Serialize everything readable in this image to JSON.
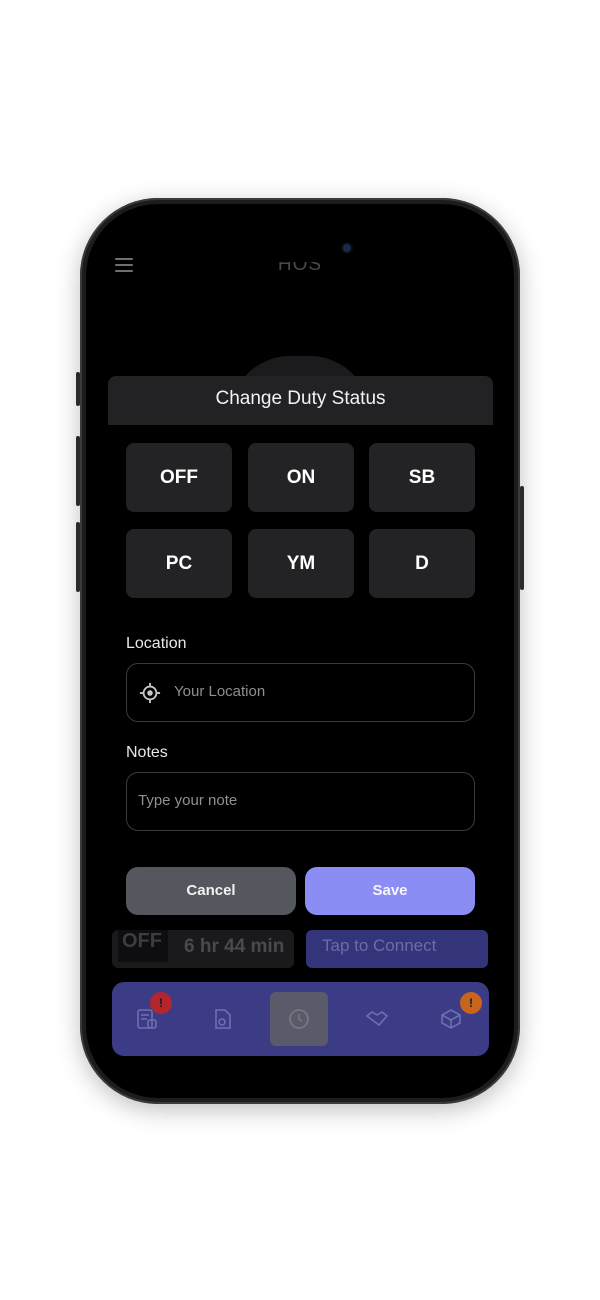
{
  "app": {
    "title": "HOS"
  },
  "modal": {
    "title": "Change Duty Status",
    "statuses": [
      "OFF",
      "ON",
      "SB",
      "PC",
      "YM",
      "D"
    ],
    "location": {
      "label": "Location",
      "placeholder": "Your Location",
      "icon": "crosshair-location-icon"
    },
    "notes": {
      "label": "Notes",
      "placeholder": "Type your note"
    },
    "cancel_label": "Cancel",
    "save_label": "Save"
  },
  "background": {
    "current_status": "OFF",
    "remaining_time": "6 hr 44 min",
    "connect_label": "Tap to Connect"
  },
  "bottom_nav": {
    "items": [
      {
        "icon": "logs-icon",
        "badge": "!"
      },
      {
        "icon": "document-icon"
      },
      {
        "icon": "clock-icon"
      },
      {
        "icon": "handshake-icon"
      },
      {
        "icon": "box-icon",
        "badge": "!"
      }
    ]
  },
  "colors": {
    "accent": "#8b8cf4",
    "nav_background": "#3b3b86",
    "badge_red": "#b3262d",
    "badge_orange": "#c8641e",
    "button_dark": "#232325"
  }
}
